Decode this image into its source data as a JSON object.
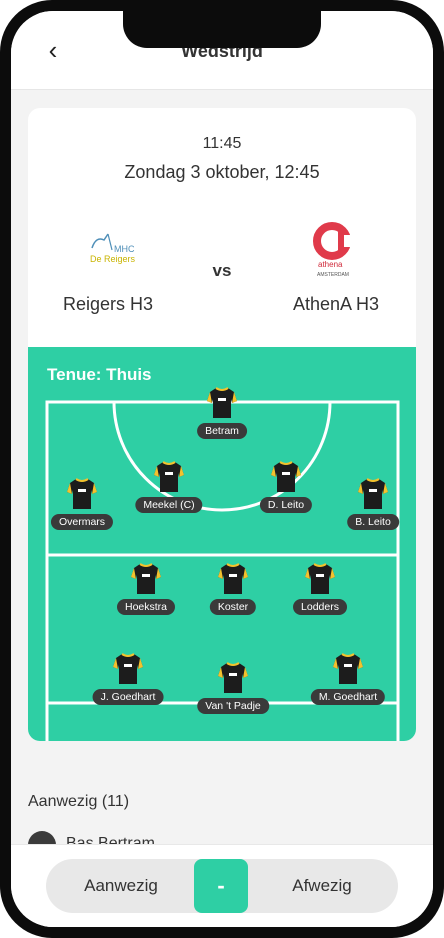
{
  "header": {
    "title": "Wedstrijd",
    "back_icon": "chevron-left-icon"
  },
  "match": {
    "time": "11:45",
    "date": "Zondag 3 oktober, 12:45",
    "vs": "vs",
    "home": {
      "name": "Reigers H3",
      "logo_text_top": "MHC",
      "logo_text_bottom": "De Reigers"
    },
    "away": {
      "name": "AthenA H3",
      "logo_text_top": "athena",
      "logo_text_bottom": "AMSTERDAM"
    }
  },
  "lineup": {
    "tenue": "Tenue: Thuis",
    "players": [
      {
        "id": "betram",
        "name": "Betram"
      },
      {
        "id": "overmars",
        "name": "Overmars"
      },
      {
        "id": "meekel",
        "name": "Meekel (C)"
      },
      {
        "id": "d-leito",
        "name": "D. Leito"
      },
      {
        "id": "b-leito",
        "name": "B. Leito"
      },
      {
        "id": "hoekstra",
        "name": "Hoekstra"
      },
      {
        "id": "koster",
        "name": "Koster"
      },
      {
        "id": "lodders",
        "name": "Lodders"
      },
      {
        "id": "j-goedhart",
        "name": "J. Goedhart"
      },
      {
        "id": "van-t-padje",
        "name": "Van 't Padje"
      },
      {
        "id": "m-goedhart",
        "name": "M. Goedhart"
      }
    ]
  },
  "attendance": {
    "title": "Aanwezig (11)",
    "items": [
      {
        "name": "Bas Bertram"
      }
    ]
  },
  "actions": {
    "present": "Aanwezig",
    "neutral": "-",
    "absent": "Afwezig"
  },
  "colors": {
    "accent": "#2ecfa4",
    "shirt": "#1c1c1c",
    "shirt_trim": "#f2c22e",
    "badge": "#3a3a3a"
  }
}
